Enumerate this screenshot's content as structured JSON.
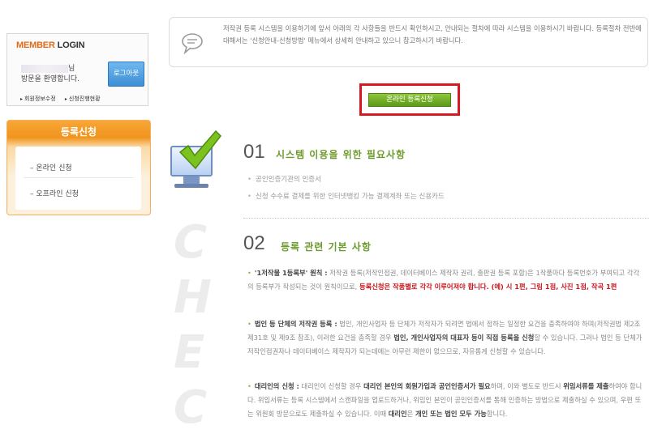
{
  "login": {
    "title_member": "MEMBER",
    "title_login": "LOGIN",
    "welcome_suffix": "님",
    "welcome_line2": "방문을 환영합니다.",
    "logout_label": "로그아웃",
    "links": [
      "회원정보수정",
      "신청진행현황"
    ]
  },
  "registration_menu": {
    "title": "등록신청",
    "items": [
      "온라인 신청",
      "오프라인 신청"
    ]
  },
  "notice": {
    "icon": "speech-bubble-icon",
    "text": "저작권 등록 시스템을 이용하기에 앞서 아래의 각 사항들을 반드시 확인하시고, 안내되는 절차에 따라 시스템을 이용하시기 바랍니다. 등록절차 전반에 대해서는 '신청안내-신청방법' 메뉴에서 상세히 안내하고 있으니 참고하시기 바랍니다."
  },
  "online_button": {
    "label": "온라인 등록신청"
  },
  "check_graphic": {
    "word": "CHEC"
  },
  "section1": {
    "number": "01",
    "title": "시스템 이용을 위한 필요사항",
    "bullets": [
      "공인인증기관의 인증서",
      "신청 수수료 결제를 위한 인터넷뱅킹 가능 결제계좌 또는 신용카드"
    ]
  },
  "section2": {
    "number": "02",
    "title": "등록 관련 기본 사항",
    "p1_head": "'1저작물 1등록부' 원칙 :",
    "p1_body": " 저작권 등록(저작인접권, 데이터베이스 제작자 권리, 출판권 등록 포함)은 1작품마다 등록번호가 부여되고 각각의 등록부가 작성되는 것이 원칙이므로, ",
    "p1_red": "등록신청은 작품별로 각각 이루어져야 합니다. (예) 시 1편, 그림 1점, 사진 1점, 작곡 1편",
    "p2_head": "법인 등 단체의 저작권 등록 :",
    "p2_body1": " 법인, 개인사업자 등 단체가 저작자가 되려면 법에서 정하는 일정한 요건을 충족하여야 하며(저작권법 제2조 제31호 및 제9조 참조), 이러한 요건을 충족할 경우 ",
    "p2_bold": "법인, 개인사업자의 대표자 등이 직접 등록을 신청",
    "p2_body2": "할 수 있습니다. 그러나 법인 등 단체가 저작인접권자나 데이터베이스 제작자가 되는데에는 아무런 제한이 없으므로, 자유롭게 신청할 수 있습니다.",
    "p3_head": "대리인의 신청 :",
    "p3_body1": " 대리인이 신청할 경우 ",
    "p3_bold1": "대리인 본인의 회원가입과 공인인증서가 필요",
    "p3_body2": "하며, 이와 별도로 반드시 ",
    "p3_bold2": "위임서류를 제출",
    "p3_body3": "하여야 합니다. 위임서류는 등록 시스템에서 스캔파일을 업로드하거나, 위임인 본인이 공인인증서를 통해 인증하는 방법으로 제출하실 수 있으며, 우편 또는 위원회 방문으로도 제출하실 수 있습니다. 이때 ",
    "p3_bold3": "대리인",
    "p3_body4": "은 ",
    "p3_bold4": "개인 또는 법인 모두 가능",
    "p3_body5": "합니다."
  }
}
